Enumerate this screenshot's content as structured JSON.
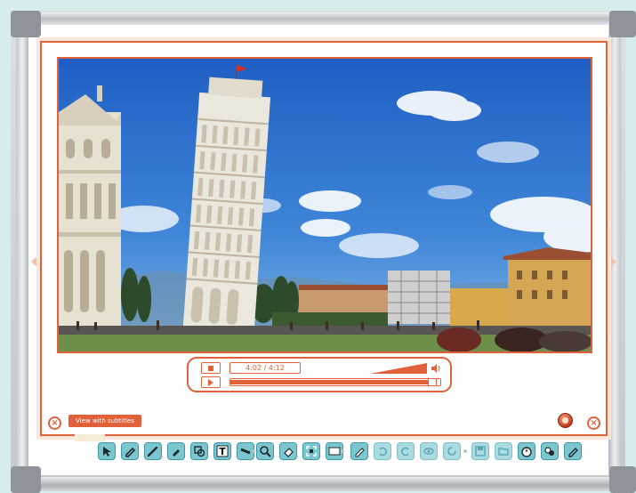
{
  "video": {
    "current_time": "4:02",
    "separator": "/",
    "duration": "4:12",
    "progress_fraction": 0.965,
    "volume_fraction": 1.0
  },
  "buttons": {
    "subtitles": "View with subtitles",
    "close": "×"
  },
  "toolbar": {
    "tools": [
      {
        "icon": "pointer-icon",
        "enabled": true
      },
      {
        "icon": "pen-icon",
        "enabled": true
      },
      {
        "icon": "brush-icon",
        "enabled": true
      },
      {
        "icon": "highlighter-icon",
        "enabled": true
      },
      {
        "icon": "shapes-icon",
        "enabled": true
      },
      {
        "icon": "text-icon",
        "label": "T",
        "enabled": true
      },
      {
        "icon": "line-tool-icon",
        "enabled": true
      },
      {
        "icon": "magnifier-icon",
        "enabled": true
      },
      {
        "icon": "eraser-icon",
        "enabled": true
      },
      {
        "icon": "fullscreen-icon",
        "enabled": true
      },
      {
        "icon": "blank-page-icon",
        "enabled": true
      },
      {
        "icon": "pencil-icon",
        "enabled": true
      },
      {
        "icon": "undo-icon",
        "enabled": false
      },
      {
        "icon": "redo-icon",
        "enabled": false
      },
      {
        "icon": "eye-icon",
        "enabled": false
      },
      {
        "icon": "refresh-icon",
        "enabled": false
      },
      {
        "icon": "save-icon",
        "enabled": false
      },
      {
        "icon": "folder-icon",
        "enabled": false
      },
      {
        "icon": "timer-icon",
        "enabled": true
      },
      {
        "icon": "group-icon",
        "enabled": true
      },
      {
        "icon": "settings-pen-icon",
        "enabled": true
      }
    ]
  },
  "colors": {
    "accent": "#e0613a",
    "toolbar": "#7cc6cf",
    "background": "#d7ecec"
  }
}
